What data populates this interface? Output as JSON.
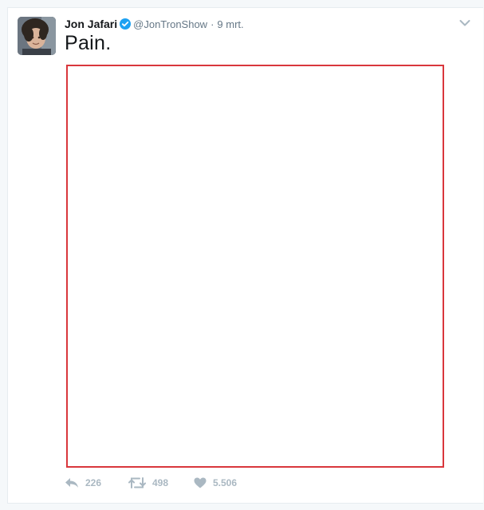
{
  "tweet": {
    "author": {
      "full_name": "Jon Jafari",
      "username": "@JonTronShow",
      "verified": true,
      "avatar_icon": "profile-photo"
    },
    "separator": "·",
    "timestamp": "9 mrt.",
    "text": "Pain.",
    "media": {
      "border_color": "#d9373c"
    },
    "actions": {
      "reply_count": "226",
      "retweet_count": "498",
      "like_count": "5.506"
    },
    "menu_icon": "chevron-down-icon"
  },
  "colors": {
    "verified_blue": "#1da1f2",
    "icon_gray": "#aab8c2",
    "secondary_text": "#657786",
    "primary_text": "#14171a"
  }
}
